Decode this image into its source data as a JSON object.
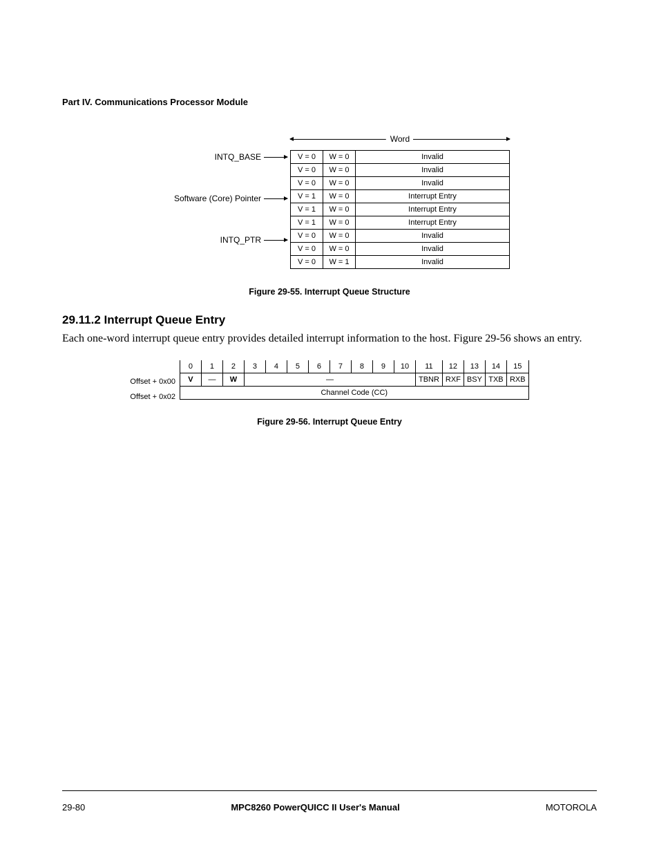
{
  "part_title": "Part IV.  Communications Processor Module",
  "fig55": {
    "word_label": "Word",
    "pointers": {
      "base": "INTQ_BASE",
      "soft": "Software (Core) Pointer",
      "ptr": "INTQ_PTR"
    },
    "rows": [
      {
        "v": "V = 0",
        "w": "W = 0",
        "d": "Invalid"
      },
      {
        "v": "V = 0",
        "w": "W = 0",
        "d": "Invalid"
      },
      {
        "v": "V = 0",
        "w": "W = 0",
        "d": "Invalid"
      },
      {
        "v": "V = 1",
        "w": "W = 0",
        "d": "Interrupt Entry"
      },
      {
        "v": "V = 1",
        "w": "W = 0",
        "d": "Interrupt Entry"
      },
      {
        "v": "V = 1",
        "w": "W = 0",
        "d": "Interrupt Entry"
      },
      {
        "v": "V = 0",
        "w": "W = 0",
        "d": "Invalid"
      },
      {
        "v": "V = 0",
        "w": "W = 0",
        "d": "Invalid"
      },
      {
        "v": "V = 0",
        "w": "W = 1",
        "d": "Invalid"
      }
    ],
    "caption": "Figure 29-55. Interrupt Queue Structure"
  },
  "section": {
    "heading": "29.11.2  Interrupt Queue Entry",
    "body": "Each one-word interrupt queue entry provides detailed interrupt information to the host. Figure 29-56 shows an entry."
  },
  "fig56": {
    "bits": [
      "0",
      "1",
      "2",
      "3",
      "4",
      "5",
      "6",
      "7",
      "8",
      "9",
      "10",
      "11",
      "12",
      "13",
      "14",
      "15"
    ],
    "offset0_label": "Offset + 0x00",
    "offset2_label": "Offset + 0x02",
    "row0": {
      "c0": "V",
      "c1": "—",
      "c2": "W",
      "mid": "—",
      "c11": "TBNR",
      "c12": "RXF",
      "c13": "BSY",
      "c14": "TXB",
      "c15": "RXB"
    },
    "row1": "Channel Code (CC)",
    "caption": "Figure 29-56. Interrupt Queue Entry"
  },
  "footer": {
    "left": "29-80",
    "center": "MPC8260 PowerQUICC II User's Manual",
    "right": "MOTOROLA"
  }
}
